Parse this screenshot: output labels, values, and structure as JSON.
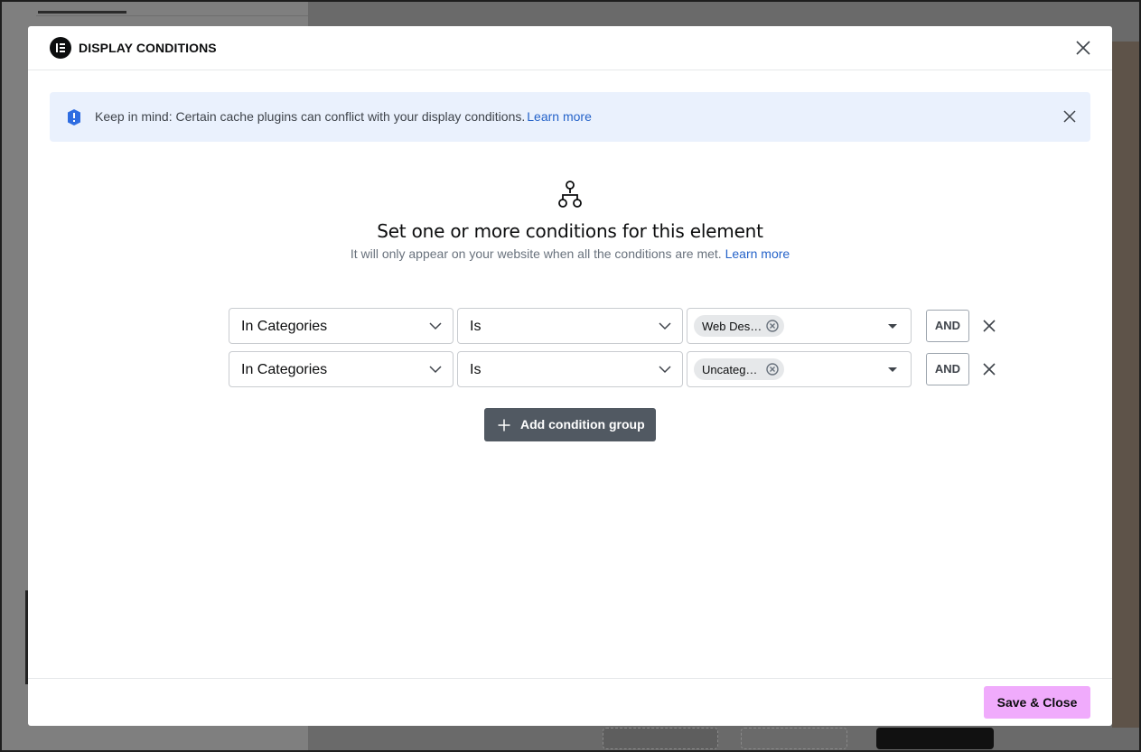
{
  "modal": {
    "title": "DISPLAY CONDITIONS"
  },
  "alert": {
    "text": "Keep in mind: Certain cache plugins can conflict with your display conditions.",
    "link": "Learn more"
  },
  "intro": {
    "title": "Set one or more conditions for this element",
    "subtitle": "It will only appear on your website when all the conditions are met.",
    "link": "Learn more"
  },
  "conditions": [
    {
      "type": "In Categories",
      "operator": "Is",
      "value_chip": "Web Design",
      "connector": "AND"
    },
    {
      "type": "In Categories",
      "operator": "Is",
      "value_chip": "Uncategorized",
      "connector": "AND"
    }
  ],
  "actions": {
    "add_group": "Add condition group",
    "save": "Save & Close"
  },
  "colors": {
    "alert_bg": "#eaf1fd",
    "link": "#2563c9",
    "add_group_bg": "#515962",
    "save_bg": "#f0abfc"
  },
  "icons": {
    "logo": "elementor-logo-icon",
    "close": "close-icon",
    "info": "info-icon",
    "hierarchy": "hierarchy-icon",
    "chevron": "chevron-down-icon",
    "chip_remove": "circle-x-icon",
    "plus": "plus-icon"
  }
}
